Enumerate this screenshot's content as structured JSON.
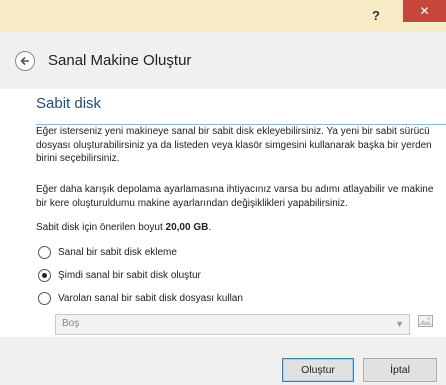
{
  "window": {
    "help_label": "?",
    "close_label": "✕"
  },
  "header": {
    "title": "Sanal Makine Oluştur"
  },
  "section": {
    "title": "Sabit disk",
    "paragraph1": "Eğer isterseniz yeni makineye sanal bir sabit disk ekleyebilirsiniz. Ya yeni bir sabit sürücü dosyası oluşturabilirsiniz ya da listeden veya klasör simgesini kullanarak başka bir yerden birini seçebilirsiniz.",
    "paragraph2": "Eğer daha karışık depolama ayarlamasına ihtiyacınız varsa bu adımı atlayabilir ve makine bir kere oluşturuldumu makine ayarlarından değişiklikleri yapabilirsiniz.",
    "recommended_prefix": "Sabit disk için önerilen boyut ",
    "recommended_size": "20,00 GB",
    "recommended_suffix": "."
  },
  "options": [
    {
      "label": "Sanal bir sabit disk ekleme",
      "checked": false
    },
    {
      "label": "Şimdi sanal bir sabit disk oluştur",
      "checked": true
    },
    {
      "label": "Varolan sanal bir sabit disk dosyası kullan",
      "checked": false
    }
  ],
  "disk_select": {
    "value": "Boş"
  },
  "buttons": {
    "create": "Oluştur",
    "cancel": "İptal"
  },
  "icons": {
    "back": "back-arrow-icon",
    "folder": "folder-icon",
    "dropdown": "chevron-down-icon"
  }
}
